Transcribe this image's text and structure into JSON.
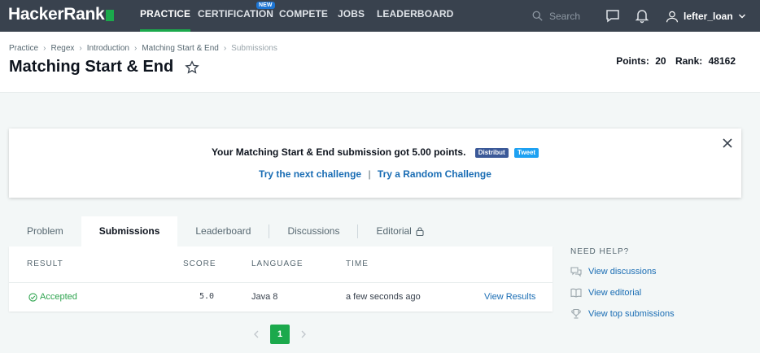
{
  "nav": {
    "logo": "HackerRank",
    "items": [
      "PRACTICE",
      "CERTIFICATION",
      "COMPETE",
      "JOBS",
      "LEADERBOARD"
    ],
    "new_badge": "NEW",
    "search_placeholder": "Search",
    "username": "lefter_loan"
  },
  "breadcrumb": [
    "Practice",
    "Regex",
    "Introduction",
    "Matching Start & End",
    "Submissions"
  ],
  "page": {
    "title": "Matching Start & End",
    "points_label": "Points:",
    "points_value": "20",
    "rank_label": "Rank:",
    "rank_value": "48162"
  },
  "banner": {
    "message": "Your Matching Start & End submission got 5.00 points.",
    "share_fb": "Distribut",
    "share_tw": "Tweet",
    "next_link": "Try the next challenge",
    "separator": "|",
    "random_link": "Try a Random Challenge"
  },
  "tabs": [
    "Problem",
    "Submissions",
    "Leaderboard",
    "Discussions",
    "Editorial"
  ],
  "table": {
    "headers": [
      "RESULT",
      "SCORE",
      "LANGUAGE",
      "TIME"
    ],
    "rows": [
      {
        "result": "Accepted",
        "score": "5.0",
        "language": "Java 8",
        "time": "a few seconds ago",
        "action": "View Results"
      }
    ]
  },
  "pagination": {
    "current": "1"
  },
  "help": {
    "title": "NEED HELP?",
    "items": [
      "View discussions",
      "View editorial",
      "View top submissions"
    ]
  },
  "colors": {
    "nav_bg": "#39424e",
    "accent_green": "#1ba94c",
    "link_blue": "#1a6db4"
  }
}
